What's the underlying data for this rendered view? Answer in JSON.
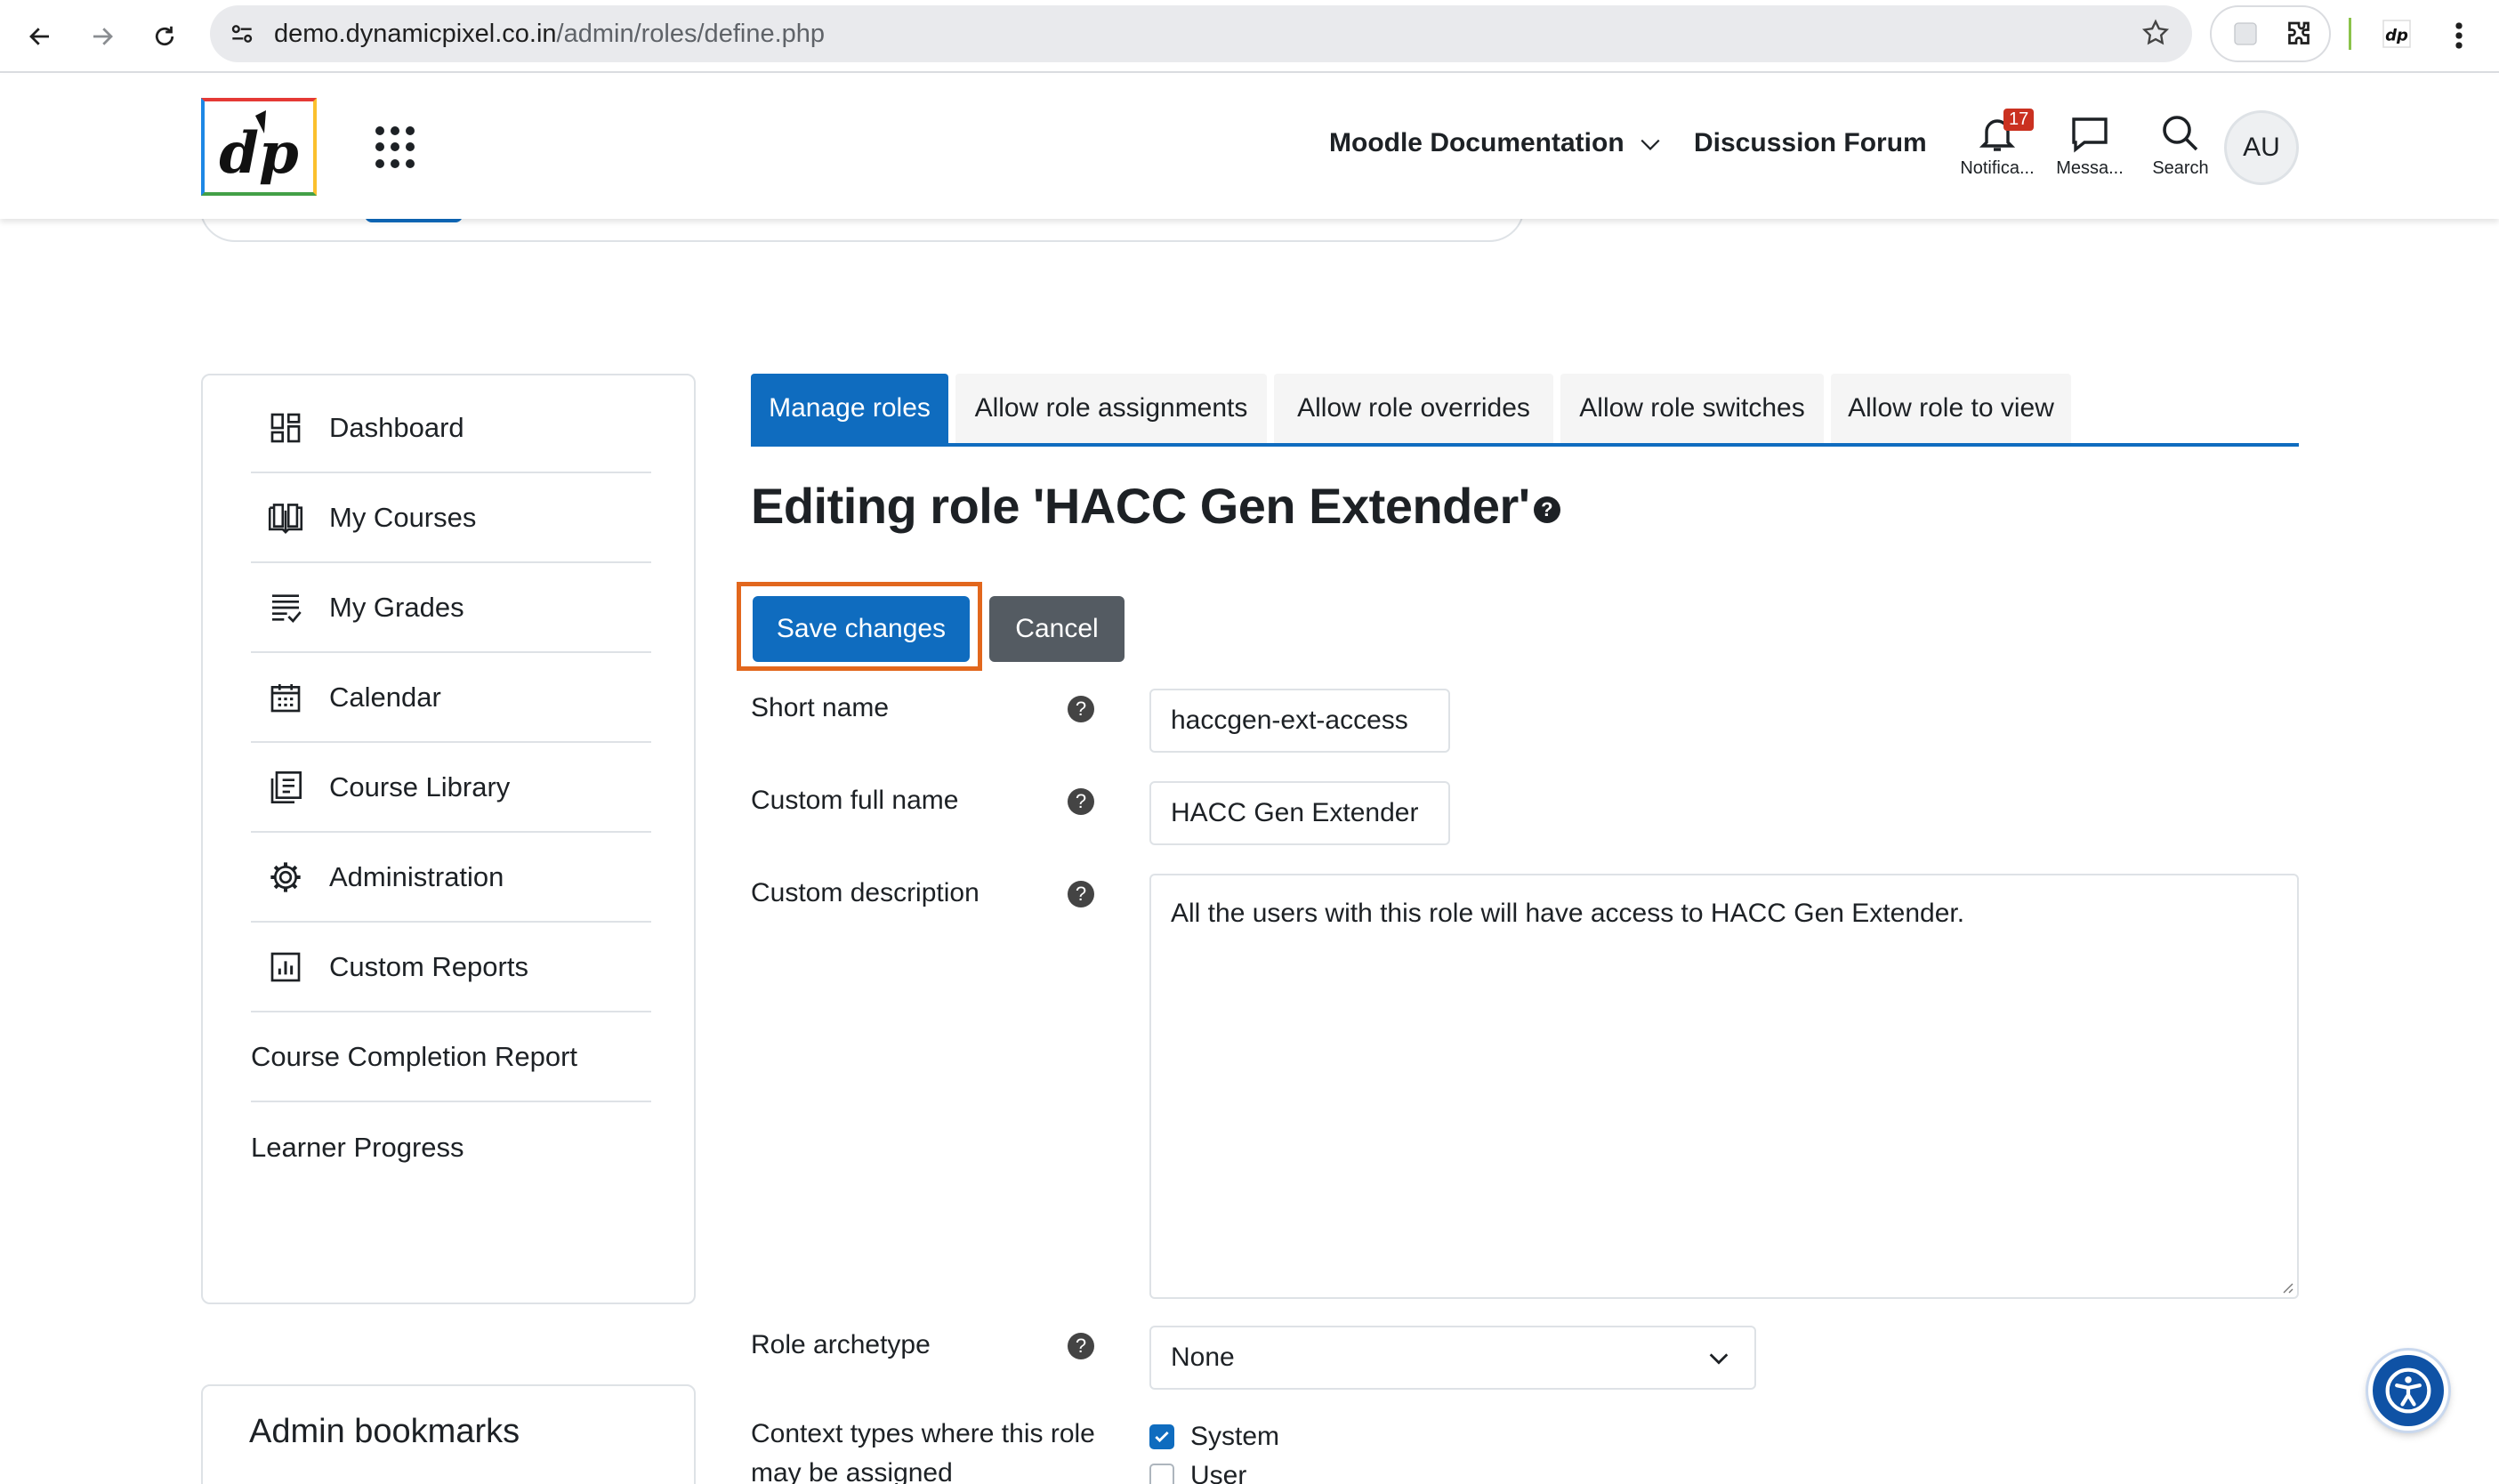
{
  "browser": {
    "url_host": "demo.dynamicpixel.co.in",
    "url_path": "/admin/roles/define.php"
  },
  "navbar": {
    "links": [
      "Moodle Documentation",
      "Discussion Forum"
    ],
    "notifications_label": "Notifica...",
    "notifications_count": "17",
    "messages_label": "Messa...",
    "search_label": "Search",
    "avatar_initials": "AU"
  },
  "sidebar": {
    "items": [
      {
        "label": "Dashboard",
        "icon": "dashboard-icon"
      },
      {
        "label": "My Courses",
        "icon": "book-icon"
      },
      {
        "label": "My Grades",
        "icon": "grades-list-icon"
      },
      {
        "label": "Calendar",
        "icon": "calendar-icon"
      },
      {
        "label": "Course Library",
        "icon": "library-icon"
      },
      {
        "label": "Administration",
        "icon": "gear-icon"
      },
      {
        "label": "Custom Reports",
        "icon": "report-chart-icon"
      },
      {
        "label": "Course Completion Report",
        "icon": ""
      },
      {
        "label": "Learner Progress",
        "icon": ""
      }
    ],
    "bookmarks_title": "Admin bookmarks"
  },
  "tabs": [
    {
      "label": "Manage roles",
      "active": true
    },
    {
      "label": "Allow role assignments",
      "active": false
    },
    {
      "label": "Allow role overrides",
      "active": false
    },
    {
      "label": "Allow role switches",
      "active": false
    },
    {
      "label": "Allow role to view",
      "active": false
    }
  ],
  "page": {
    "title": "Editing role 'HACC Gen Extender'",
    "help_glyph": "?"
  },
  "actions": {
    "save_label": "Save changes",
    "cancel_label": "Cancel"
  },
  "form": {
    "short_name_label": "Short name",
    "short_name_value": "haccgen-ext-access",
    "full_name_label": "Custom full name",
    "full_name_value": "HACC Gen Extender",
    "description_label": "Custom description",
    "description_value": "All the users with this role will have access to HACC Gen Extender.",
    "archetype_label": "Role archetype",
    "archetype_value": "None",
    "context_label_line1": "Context types where this role",
    "context_label_line2": "may be assigned",
    "contexts": [
      {
        "label": "System",
        "checked": true
      },
      {
        "label": "User",
        "checked": false
      }
    ]
  },
  "colors": {
    "primary": "#0f6cbf",
    "secondary": "#545b62",
    "focus": "#e2671d",
    "badge": "#ca3120"
  }
}
